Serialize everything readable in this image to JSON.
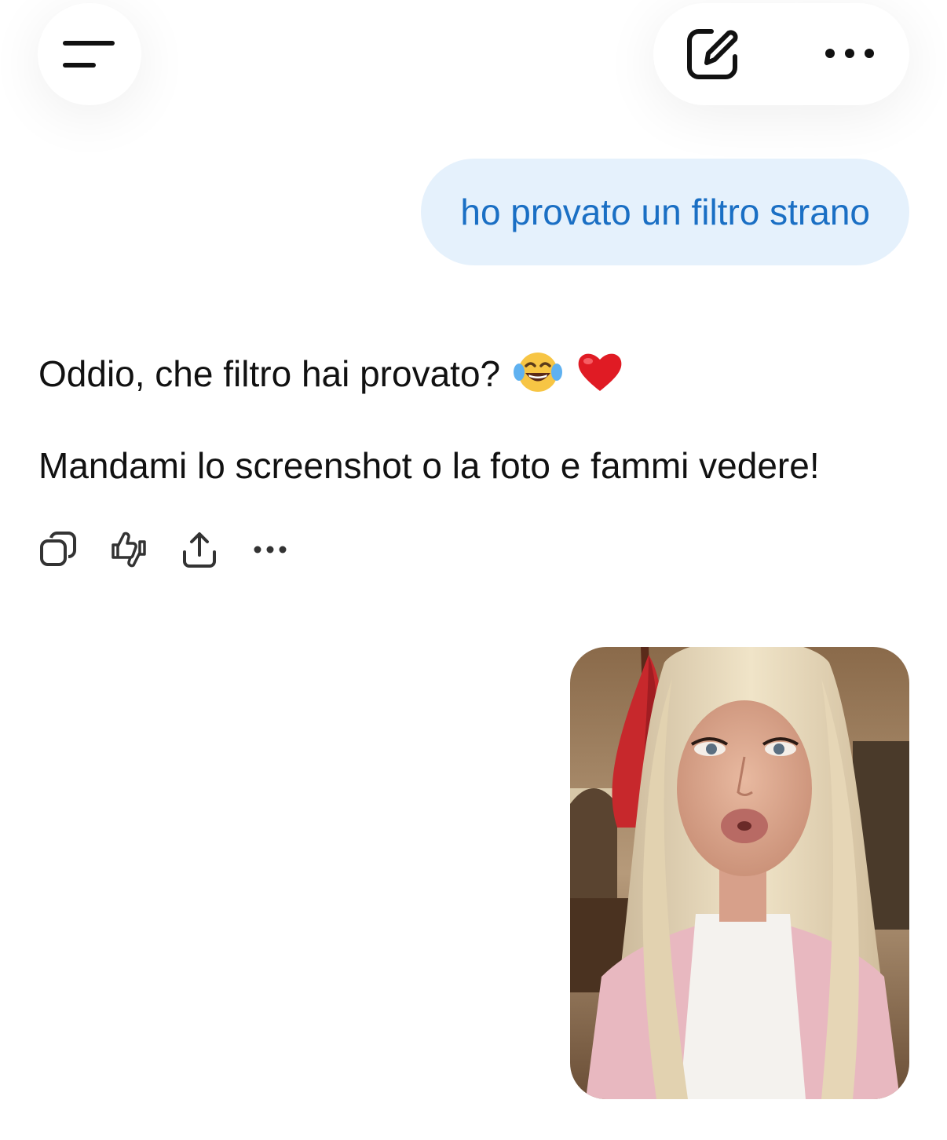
{
  "header": {
    "menu_icon": "menu-lines-icon",
    "compose_icon": "edit-compose-icon",
    "more_icon": "more-horizontal-icon"
  },
  "conversation": {
    "user_message": "ho provato un filtro strano",
    "assistant_line_1": "Oddio, che filtro hai provato?",
    "assistant_emoji_1": "face-with-tears-of-joy",
    "assistant_emoji_2": "red-heart",
    "assistant_line_2": "Mandami lo screenshot o la foto e fammi vedere!",
    "actions": [
      "copy-icon",
      "thumbs-feedback-icon",
      "share-icon",
      "more-icon"
    ]
  },
  "colors": {
    "user_bubble_bg": "#e5f1fc",
    "user_text": "#1a6fc4",
    "assistant_text": "#111111"
  }
}
